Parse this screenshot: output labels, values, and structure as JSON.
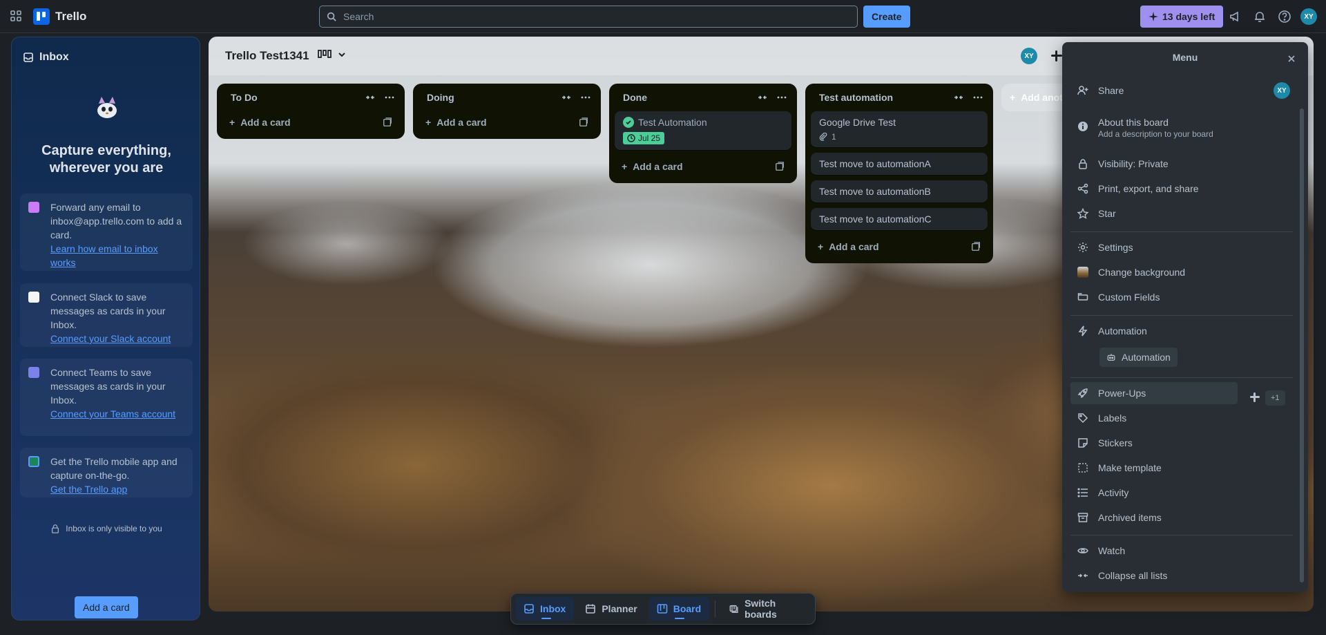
{
  "app": {
    "name": "Trello"
  },
  "topbar": {
    "search_placeholder": "Search",
    "create_label": "Create",
    "trial_label": "13 days left",
    "user_initials": "XY"
  },
  "inbox": {
    "title": "Inbox",
    "headline_1": "Capture everything,",
    "headline_2": "wherever you are",
    "cards": [
      {
        "text": "Forward any email to inbox@app.trello.com to add a card.",
        "link": "Learn how email to inbox works"
      },
      {
        "text": "Connect Slack to save messages as cards in your Inbox.",
        "link": "Connect your Slack account"
      },
      {
        "text": "Connect Teams to save messages as cards in your Inbox.",
        "link": "Connect your Teams account"
      },
      {
        "text": "Get the Trello mobile app and capture on-the-go.",
        "link": "Get the Trello app"
      }
    ],
    "visibility_note": "Inbox is only visible to you",
    "add_card_label": "Add a card"
  },
  "board": {
    "title": "Trello Test1341",
    "member_initials": "XY",
    "add_list_label": "Add another list",
    "lists": [
      {
        "name": "To Do",
        "cards": [],
        "add_label": "Add a card"
      },
      {
        "name": "Doing",
        "cards": [],
        "add_label": "Add a card"
      },
      {
        "name": "Done",
        "add_label": "Add a card",
        "cards": [
          {
            "title": "Test Automation",
            "due": "Jul 25",
            "complete": true
          }
        ]
      },
      {
        "name": "Test automation",
        "add_label": "Add a card",
        "cards": [
          {
            "title": "Google Drive Test",
            "attachments": "1"
          },
          {
            "title": "Test move to automationA"
          },
          {
            "title": "Test move to automationB"
          },
          {
            "title": "Test move to automationC"
          }
        ]
      }
    ]
  },
  "menu": {
    "title": "Menu",
    "share": "Share",
    "about_title": "About this board",
    "about_sub": "Add a description to your board",
    "visibility": "Visibility: Private",
    "print": "Print, export, and share",
    "star": "Star",
    "settings": "Settings",
    "change_background": "Change background",
    "custom_fields": "Custom Fields",
    "automation": "Automation",
    "automation_button": "Automation",
    "power_ups": "Power-Ups",
    "power_ups_count": "+1",
    "labels": "Labels",
    "stickers": "Stickers",
    "make_template": "Make template",
    "activity": "Activity",
    "archived": "Archived items",
    "watch": "Watch",
    "collapse": "Collapse all lists"
  },
  "bottomnav": {
    "inbox": "Inbox",
    "planner": "Planner",
    "board": "Board",
    "switch": "Switch boards"
  }
}
